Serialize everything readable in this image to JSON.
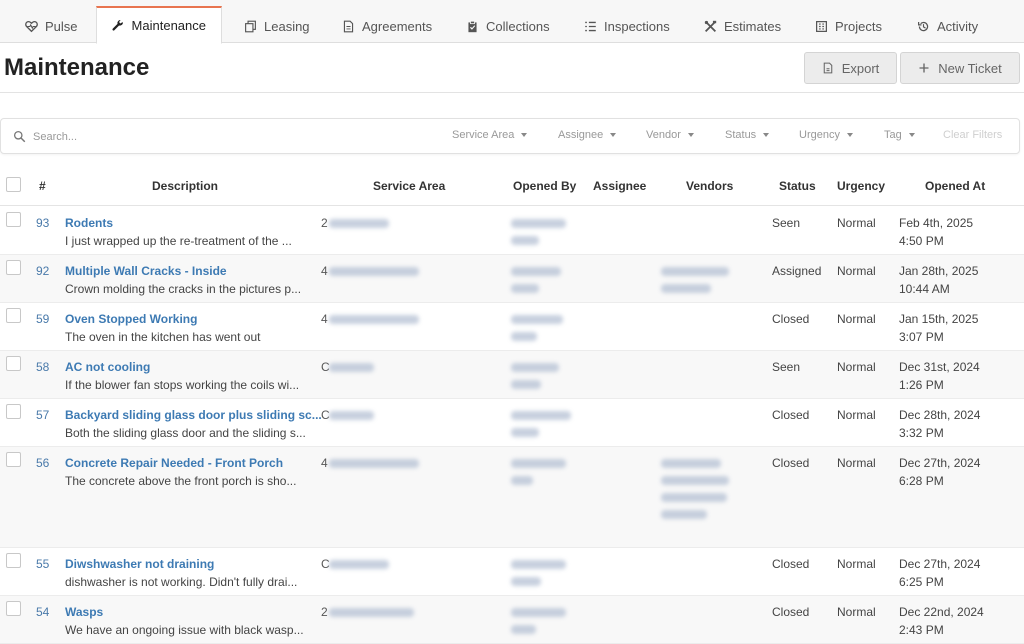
{
  "tabs": [
    {
      "label": "Pulse",
      "icon": "heart-pulse-icon"
    },
    {
      "label": "Maintenance",
      "icon": "wrench-icon",
      "active": true
    },
    {
      "label": "Leasing",
      "icon": "copy-icon"
    },
    {
      "label": "Agreements",
      "icon": "file-icon"
    },
    {
      "label": "Collections",
      "icon": "clipboard-icon"
    },
    {
      "label": "Inspections",
      "icon": "list-icon"
    },
    {
      "label": "Estimates",
      "icon": "tools-icon"
    },
    {
      "label": "Projects",
      "icon": "building-icon"
    },
    {
      "label": "Activity",
      "icon": "history-icon"
    }
  ],
  "page": {
    "title": "Maintenance"
  },
  "actions": {
    "export_label": "Export",
    "new_ticket_label": "New Ticket"
  },
  "search": {
    "placeholder": "Search..."
  },
  "filters": [
    {
      "label": "Service Area"
    },
    {
      "label": "Assignee"
    },
    {
      "label": "Vendor"
    },
    {
      "label": "Status"
    },
    {
      "label": "Urgency"
    },
    {
      "label": "Tag"
    }
  ],
  "clear_filters_label": "Clear Filters",
  "columns": {
    "number": "#",
    "description": "Description",
    "service_area": "Service Area",
    "opened_by": "Opened By",
    "assignee": "Assignee",
    "vendors": "Vendors",
    "status": "Status",
    "urgency": "Urgency",
    "opened_at": "Opened At"
  },
  "tickets": [
    {
      "number": "93",
      "title": "Rodents",
      "description": "I just wrapped up the re-treatment of the ...",
      "service_area_prefix": "2",
      "status": "Seen",
      "urgency": "Normal",
      "date": "Feb 4th, 2025",
      "time": "4:50 PM"
    },
    {
      "number": "92",
      "title": "Multiple Wall Cracks - Inside",
      "description": "Crown molding the cracks in the pictures p...",
      "service_area_prefix": "4",
      "status": "Assigned",
      "urgency": "Normal",
      "date": "Jan 28th, 2025",
      "time": "10:44 AM"
    },
    {
      "number": "59",
      "title": "Oven Stopped Working",
      "description": "The oven in the kitchen has went out",
      "service_area_prefix": "4",
      "status": "Closed",
      "urgency": "Normal",
      "date": "Jan 15th, 2025",
      "time": "3:07 PM"
    },
    {
      "number": "58",
      "title": "AC not cooling",
      "description": "If the blower fan stops working the coils wi...",
      "service_area_prefix": "C",
      "status": "Seen",
      "urgency": "Normal",
      "date": "Dec 31st, 2024",
      "time": "1:26 PM"
    },
    {
      "number": "57",
      "title": "Backyard sliding glass door plus sliding sc...",
      "description": "Both the sliding glass door and the sliding s...",
      "service_area_prefix": "C",
      "status": "Closed",
      "urgency": "Normal",
      "date": "Dec 28th, 2024",
      "time": "3:32 PM"
    },
    {
      "number": "56",
      "title": "Concrete Repair Needed - Front Porch",
      "description": "The concrete above the front porch is sho...",
      "service_area_prefix": "4",
      "status": "Closed",
      "urgency": "Normal",
      "date": "Dec 27th, 2024",
      "time": "6:28 PM"
    },
    {
      "number": "55",
      "title": "Diwshwasher not draining",
      "description": "dishwasher is not working. Didn't fully drai...",
      "service_area_prefix": "C",
      "status": "Closed",
      "urgency": "Normal",
      "date": "Dec 27th, 2024",
      "time": "6:25 PM"
    },
    {
      "number": "54",
      "title": "Wasps",
      "description": "We have an ongoing issue with black wasp...",
      "service_area_prefix": "2",
      "status": "Closed",
      "urgency": "Normal",
      "date": "Dec 22nd, 2024",
      "time": "2:43 PM"
    }
  ]
}
